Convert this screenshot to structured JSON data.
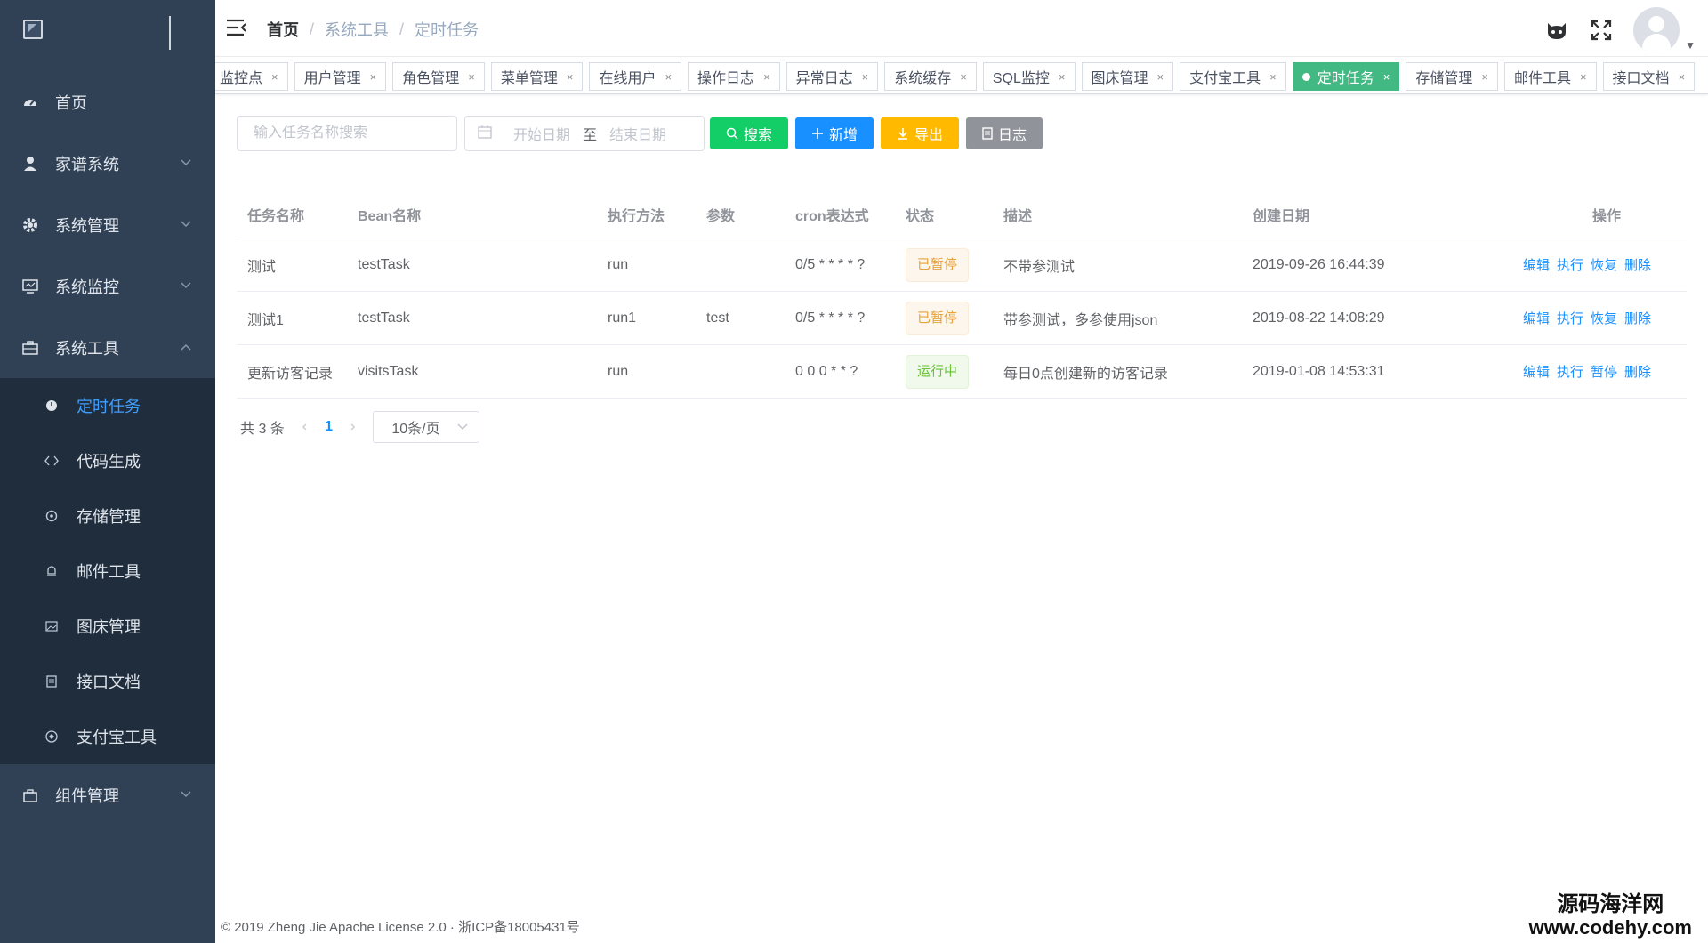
{
  "sidebar": {
    "menu": [
      {
        "label": "首页",
        "icon": "dashboard-icon"
      },
      {
        "label": "家谱系统",
        "icon": "user-tree-icon"
      },
      {
        "label": "系统管理",
        "icon": "gear-icon"
      },
      {
        "label": "系统监控",
        "icon": "monitor-icon"
      },
      {
        "label": "系统工具",
        "icon": "toolbox-icon"
      }
    ],
    "sub": [
      {
        "label": "定时任务",
        "icon": "timer-icon"
      },
      {
        "label": "代码生成",
        "icon": "code-icon"
      },
      {
        "label": "存储管理",
        "icon": "storage-icon"
      },
      {
        "label": "邮件工具",
        "icon": "mail-icon"
      },
      {
        "label": "图床管理",
        "icon": "image-icon"
      },
      {
        "label": "接口文档",
        "icon": "document-icon"
      },
      {
        "label": "支付宝工具",
        "icon": "alipay-icon"
      }
    ],
    "bottom": {
      "label": "组件管理",
      "icon": "component-icon"
    }
  },
  "breadcrumb": [
    "首页",
    "系统工具",
    "定时任务"
  ],
  "tags": [
    "监控点",
    "用户管理",
    "角色管理",
    "菜单管理",
    "在线用户",
    "操作日志",
    "异常日志",
    "系统缓存",
    "SQL监控",
    "图床管理",
    "支付宝工具",
    "定时任务",
    "存储管理",
    "邮件工具",
    "接口文档"
  ],
  "toolbar": {
    "search_placeholder": "输入任务名称搜索",
    "date_start": "开始日期",
    "date_sep": "至",
    "date_end": "结束日期",
    "search": "搜索",
    "add": "新增",
    "export": "导出",
    "log": "日志"
  },
  "table": {
    "headers": [
      "任务名称",
      "Bean名称",
      "执行方法",
      "参数",
      "cron表达式",
      "状态",
      "描述",
      "创建日期",
      "操作"
    ],
    "rows": [
      {
        "name": "测试",
        "bean": "testTask",
        "method": "run",
        "param": "",
        "cron": "0/5 * * * * ?",
        "status": "已暂停",
        "desc": "不带参测试",
        "date": "2019-09-26 16:44:39",
        "ops": [
          "编辑",
          "执行",
          "恢复",
          "删除"
        ]
      },
      {
        "name": "测试1",
        "bean": "testTask",
        "method": "run1",
        "param": "test",
        "cron": "0/5 * * * * ?",
        "status": "已暂停",
        "desc": "带参测试，多参使用json",
        "date": "2019-08-22 14:08:29",
        "ops": [
          "编辑",
          "执行",
          "恢复",
          "删除"
        ]
      },
      {
        "name": "更新访客记录",
        "bean": "visitsTask",
        "method": "run",
        "param": "",
        "cron": "0 0 0 * * ?",
        "status": "运行中",
        "desc": "每日0点创建新的访客记录",
        "date": "2019-01-08 14:53:31",
        "ops": [
          "编辑",
          "执行",
          "暂停",
          "删除"
        ]
      }
    ]
  },
  "pagination": {
    "total": "共 3 条",
    "page": "1",
    "size": "10条/页"
  },
  "footer": "© 2019 Zheng Jie Apache License 2.0 · 浙ICP备18005431号",
  "watermark": {
    "line1": "源码海洋网",
    "line2": "www.codehy.com"
  }
}
